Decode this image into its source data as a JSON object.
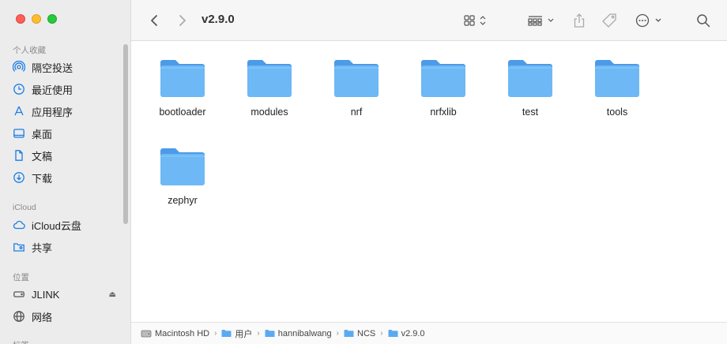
{
  "sidebar": {
    "favorites_header": "个人收藏",
    "favorites": [
      {
        "label": "隔空投送",
        "icon": "airdrop-icon"
      },
      {
        "label": "最近使用",
        "icon": "clock-icon"
      },
      {
        "label": "应用程序",
        "icon": "apps-icon"
      },
      {
        "label": "桌面",
        "icon": "desktop-icon"
      },
      {
        "label": "文稿",
        "icon": "document-icon"
      },
      {
        "label": "下载",
        "icon": "download-icon"
      }
    ],
    "icloud_header": "iCloud",
    "icloud": [
      {
        "label": "iCloud云盘",
        "icon": "cloud-icon"
      },
      {
        "label": "共享",
        "icon": "shared-folder-icon"
      }
    ],
    "locations_header": "位置",
    "locations": [
      {
        "label": "JLINK",
        "icon": "drive-icon",
        "eject": "⏏"
      },
      {
        "label": "网络",
        "icon": "globe-icon"
      }
    ],
    "tags_header": "标签"
  },
  "toolbar": {
    "title": "v2.9.0"
  },
  "files": [
    {
      "name": "bootloader"
    },
    {
      "name": "modules"
    },
    {
      "name": "nrf"
    },
    {
      "name": "nrfxlib"
    },
    {
      "name": "test"
    },
    {
      "name": "tools"
    },
    {
      "name": "zephyr"
    }
  ],
  "pathbar": [
    {
      "label": "Macintosh HD",
      "icon": "hard-disk-icon"
    },
    {
      "label": "用户",
      "icon": "folder-icon"
    },
    {
      "label": "hannibalwang",
      "icon": "folder-icon"
    },
    {
      "label": "NCS",
      "icon": "folder-icon"
    },
    {
      "label": "v2.9.0",
      "icon": "folder-icon"
    }
  ],
  "colors": {
    "accent": "#1a7ce6",
    "folder_top": "#4c9be8",
    "folder_body": "#6db8f5"
  }
}
